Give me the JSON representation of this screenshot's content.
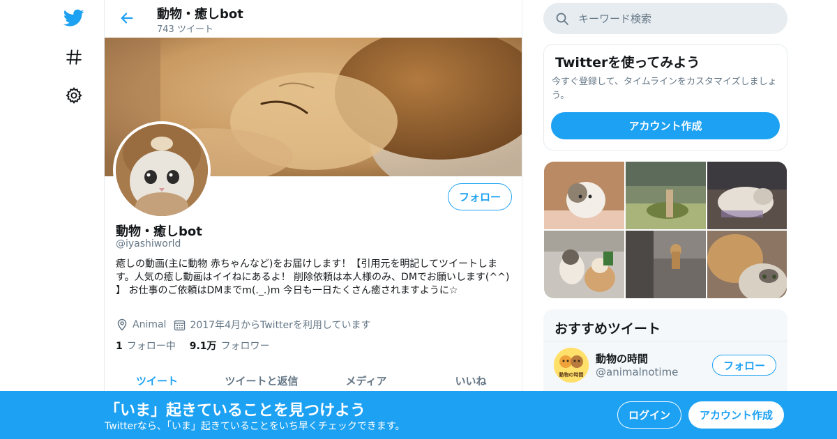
{
  "colors": {
    "brand": "#1da1f2",
    "text_primary": "#14171a",
    "text_secondary": "#657786",
    "border": "#e6ecf0"
  },
  "nav": {
    "icons": [
      "twitter-bird-icon",
      "hashtag-explore-icon",
      "gear-settings-icon"
    ]
  },
  "header": {
    "title": "動物・癒しbot",
    "tweet_count": "743 ツイート"
  },
  "profile": {
    "name": "動物・癒しbot",
    "handle": "@iyashiworld",
    "follow_label": "フォロー",
    "bio": "癒しの動画(主に動物 赤ちゃんなど)をお届けします！【引用元を明記してツイートします。人気の癒し動画はイイねにあるよ！ 削除依頼は本人様のみ、DMでお願いします(^^) 】 お仕事のご依頼はDMまでm(._.)m 今日も一日たくさん癒されますように☆",
    "location": "Animal",
    "joined": "2017年4月からTwitterを利用しています",
    "following_count": "1",
    "following_label": "フォロー中",
    "followers_count": "9.1万",
    "followers_label": "フォロワー",
    "banner_image": "golden retriever puppy sleeping",
    "avatar_image": "kitten wearing bear hood"
  },
  "tabs": [
    {
      "label": "ツイート",
      "active": true
    },
    {
      "label": "ツイートと返信",
      "active": false
    },
    {
      "label": "メディア",
      "active": false
    },
    {
      "label": "いいね",
      "active": false
    }
  ],
  "search": {
    "placeholder": "キーワード検索"
  },
  "signup_card": {
    "title": "Twitterを使ってみよう",
    "description": "今すぐ登録して、タイムラインをカスタマイズしましょう。",
    "button_label": "アカウント作成"
  },
  "media_grid": {
    "items": [
      "cat sitting",
      "outdoor play area",
      "cat lying",
      "cats playing",
      "dog in hallway",
      "dog and cat"
    ]
  },
  "recommended": {
    "title": "おすすめツイート",
    "account_name": "動物の時間",
    "account_handle": "@animalnotime",
    "follow_label": "フォロー",
    "avatar_text": "動物の時間"
  },
  "bottom_bar": {
    "title": "「いま」起きていることを見つけよう",
    "subtitle": "Twitterなら、「いま」起きていることをいち早くチェックできます。",
    "login_label": "ログイン",
    "signup_label": "アカウント作成"
  }
}
